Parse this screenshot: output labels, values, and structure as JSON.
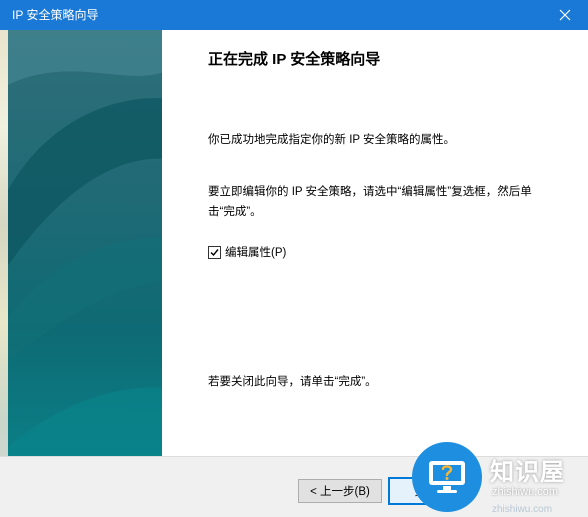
{
  "window": {
    "title": "IP 安全策略向导"
  },
  "wizard": {
    "heading": "正在完成 IP 安全策略向导",
    "completed_text": "你已成功地完成指定你的新 IP 安全策略的属性。",
    "edit_instruction": "要立即编辑你的 IP 安全策略，请选中“编辑属性”复选框，然后单击“完成”。",
    "edit_properties_label": "编辑属性(P)",
    "edit_properties_checked": true,
    "close_instruction": "若要关闭此向导，请单击“完成”。"
  },
  "buttons": {
    "back_label": "< 上一步(B)",
    "finish_label": "完成"
  },
  "watermark": {
    "brand": "知识屋",
    "url": "zhishiwu.com",
    "url_faded": "zhishiwu.com"
  },
  "colors": {
    "titlebar": "#1a79d6",
    "panel_teal": "#0e6a74",
    "accent": "#0078d7"
  },
  "icons": {
    "close": "close-icon",
    "check": "checkmark-icon",
    "watermark": "monitor-question-icon"
  }
}
